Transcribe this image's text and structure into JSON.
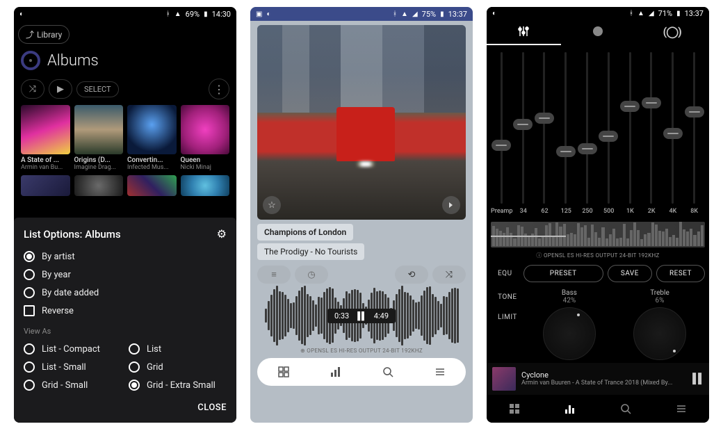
{
  "phone1": {
    "status": {
      "battery": "69%",
      "time": "14:30"
    },
    "library_btn": "Library",
    "title": "Albums",
    "select_btn": "SELECT",
    "albums": [
      {
        "title": "A State of ...",
        "artist": "Armin van Bu...",
        "bg": "linear-gradient(160deg,#2a0a2a 0%,#e030a0 50%,#f0d040 100%)"
      },
      {
        "title": "Origins (D...",
        "artist": "Imagine Drag...",
        "bg": "linear-gradient(180deg,#3a5a6a 0%,#b09a7a 50%,#2a3a2a 100%)"
      },
      {
        "title": "Convertin...",
        "artist": "Infected Mus...",
        "bg": "radial-gradient(circle at 50% 40%,#5aa0f0 0%,#0a1a3a 70%)"
      },
      {
        "title": "Queen",
        "artist": "Nicki Minaj",
        "bg": "radial-gradient(circle,#f040c0 0%,#a0207a 60%,#4a0a3a 100%)"
      }
    ],
    "albums2_bg": [
      "linear-gradient(135deg,#3a3a6a,#1a1a3a)",
      "radial-gradient(circle,#6a6a6a,#1a1a1a)",
      "linear-gradient(45deg,#a03030,#302060,#30a050)",
      "radial-gradient(circle,#60c0e0 0%,#3080b0 50%,#104060 100%)"
    ],
    "sheet": {
      "title": "List Options: Albums",
      "sort": [
        {
          "label": "By artist",
          "on": true
        },
        {
          "label": "By year",
          "on": false
        },
        {
          "label": "By date added",
          "on": false
        }
      ],
      "reverse": "Reverse",
      "view_as_label": "View As",
      "views": [
        {
          "label": "List - Compact",
          "on": false
        },
        {
          "label": "List",
          "on": false
        },
        {
          "label": "List - Small",
          "on": false
        },
        {
          "label": "Grid",
          "on": false
        },
        {
          "label": "Grid - Small",
          "on": false
        },
        {
          "label": "Grid - Extra Small",
          "on": true
        }
      ],
      "close": "CLOSE"
    }
  },
  "phone2": {
    "status": {
      "battery": "75%",
      "time": "13:37"
    },
    "track_title": "Champions of London",
    "track_artist": "The Prodigy - No Tourists",
    "elapsed": "0:33",
    "duration": "4:49",
    "output": "⊕ OPENSL ES HI-RES OUTPUT 24-BIT 192KHZ"
  },
  "phone3": {
    "status": {
      "battery": "71%",
      "time": "13:37"
    },
    "freqs": [
      "Preamp",
      "34",
      "62",
      "125",
      "250",
      "500",
      "1K",
      "2K",
      "4K",
      "8K"
    ],
    "slider_pos": [
      58,
      44,
      40,
      62,
      60,
      52,
      32,
      30,
      50,
      36
    ],
    "output": "ⓘ OPENSL ES HI-RES OUTPUT 24-BIT 192KHZ",
    "equ": "EQU",
    "preset": "PRESET",
    "save": "SAVE",
    "reset": "RESET",
    "tone": "TONE",
    "limit": "LIMIT",
    "bass": {
      "label": "Bass",
      "value": "42%"
    },
    "treble": {
      "label": "Treble",
      "value": "6%"
    },
    "now": {
      "title": "Cyclone",
      "sub": "Armin van Buuren - A State of Trance 2018 (Mixed By..."
    }
  }
}
